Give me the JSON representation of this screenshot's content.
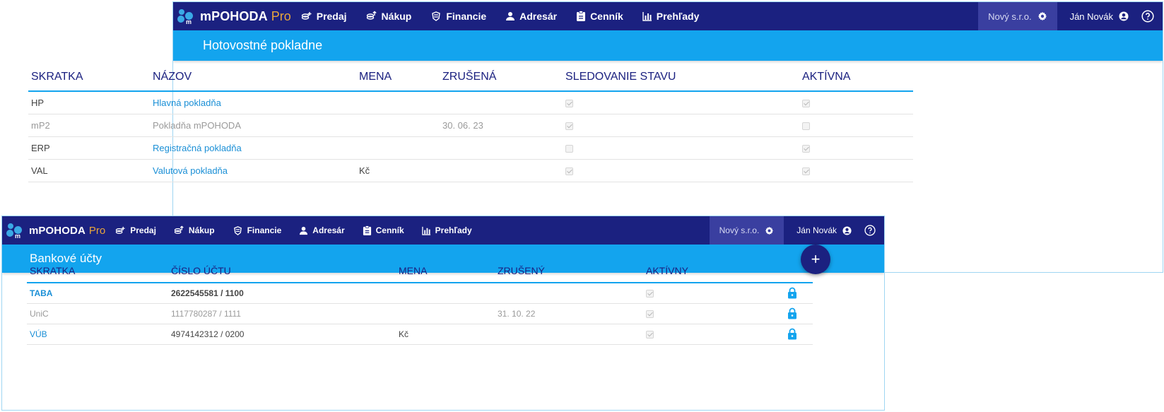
{
  "brand": {
    "name": "mPOHODA",
    "pro": "Pro"
  },
  "nav": [
    "Predaj",
    "Nákup",
    "Financie",
    "Adresár",
    "Cenník",
    "Prehľady"
  ],
  "company": "Nový s.r.o.",
  "user": "Ján Novák",
  "colors": {
    "navbar": "#1b2180",
    "titlebar": "#13a4ee",
    "accent_pro": "#e9a63b",
    "link": "#1a8fd6"
  },
  "cash": {
    "title": "Hotovostné pokladne",
    "headers": [
      "SKRATKA",
      "NÁZOV",
      "MENA",
      "ZRUŠENÁ",
      "SLEDOVANIE STAVU",
      "AKTÍVNA"
    ],
    "rows": [
      {
        "code": "HP",
        "name": "Hlavná pokladňa",
        "currency": "",
        "cancelled": "",
        "tracking": true,
        "active": true
      },
      {
        "code": "mP2",
        "name": "Pokladňa mPOHODA",
        "currency": "",
        "cancelled": "30. 06. 23",
        "tracking": true,
        "active": false
      },
      {
        "code": "ERP",
        "name": "Registračná pokladňa",
        "currency": "",
        "cancelled": "",
        "tracking": false,
        "active": true
      },
      {
        "code": "VAL",
        "name": "Valutová pokladňa",
        "currency": "Kč",
        "cancelled": "",
        "tracking": true,
        "active": true
      }
    ]
  },
  "bank": {
    "title": "Bankové účty",
    "headers": [
      "SKRATKA",
      "ČÍSLO ÚČTU",
      "MENA",
      "ZRUŠENÝ",
      "AKTÍVNY"
    ],
    "rows": [
      {
        "code": "TABA",
        "account": "2622545581 / 1100",
        "currency": "",
        "cancelled": "",
        "active": true
      },
      {
        "code": "UniC",
        "account": "1117780287 / 1111",
        "currency": "",
        "cancelled": "31. 10. 22",
        "active": true
      },
      {
        "code": "VÚB",
        "account": "4974142312 / 0200",
        "currency": "Kč",
        "cancelled": "",
        "active": true
      }
    ],
    "add_label": "+"
  }
}
